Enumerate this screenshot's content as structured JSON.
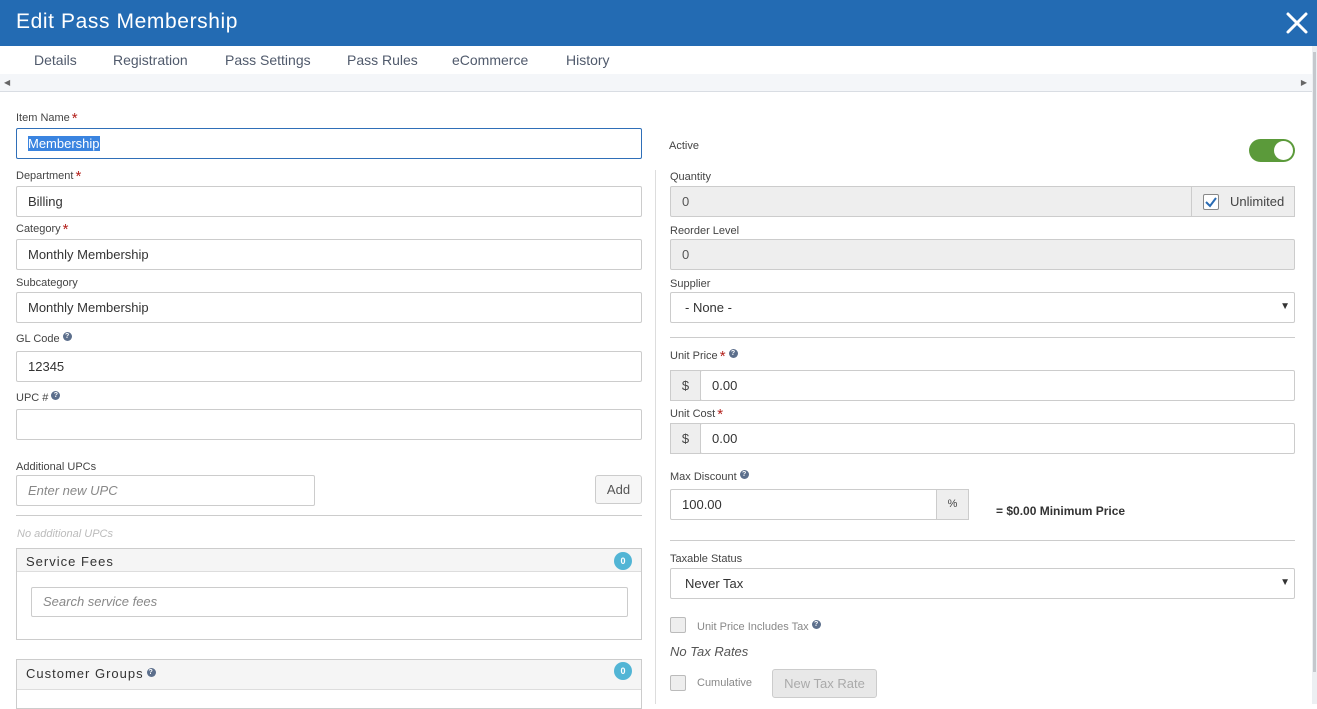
{
  "header": {
    "title": "Edit Pass Membership"
  },
  "tabs": [
    "Details",
    "Registration",
    "Pass Settings",
    "Pass Rules",
    "eCommerce",
    "History"
  ],
  "left": {
    "item_name": {
      "label": "Item Name",
      "value": "Membership"
    },
    "department": {
      "label": "Department",
      "value": "Billing"
    },
    "category": {
      "label": "Category",
      "value": "Monthly Membership"
    },
    "subcategory": {
      "label": "Subcategory",
      "value": "Monthly Membership"
    },
    "gl_code": {
      "label": "GL Code",
      "value": "12345"
    },
    "upc": {
      "label": "UPC #",
      "value": ""
    },
    "additional_upcs": {
      "label": "Additional UPCs",
      "placeholder": "Enter new UPC",
      "add_label": "Add",
      "empty_text": "No additional UPCs"
    },
    "service_fees": {
      "title": "Service Fees",
      "count": "0",
      "placeholder": "Search service fees"
    },
    "customer_groups": {
      "title": "Customer Groups",
      "count": "0"
    }
  },
  "right": {
    "active": {
      "label": "Active",
      "on": true
    },
    "quantity": {
      "label": "Quantity",
      "value": "0",
      "unlimited_label": "Unlimited",
      "unlimited": true
    },
    "reorder": {
      "label": "Reorder Level",
      "value": "0"
    },
    "supplier": {
      "label": "Supplier",
      "value": "- None -"
    },
    "unit_price": {
      "label": "Unit Price",
      "currency": "$",
      "value": "0.00"
    },
    "unit_cost": {
      "label": "Unit Cost",
      "currency": "$",
      "value": "0.00"
    },
    "max_discount": {
      "label": "Max Discount",
      "value": "100.00",
      "unit": "%",
      "min_price_text": "= $0.00 Minimum Price"
    },
    "taxable": {
      "label": "Taxable Status",
      "value": "Never Tax"
    },
    "price_includes_tax": {
      "label": "Unit Price Includes Tax"
    },
    "no_tax_rates": "No Tax Rates",
    "cumulative": {
      "label": "Cumulative"
    },
    "new_tax_rate": "New Tax Rate"
  },
  "colors": {
    "header": "#236bb3",
    "toggle": "#5b9a3a",
    "badge": "#52b5d5",
    "required": "#b3201b"
  }
}
